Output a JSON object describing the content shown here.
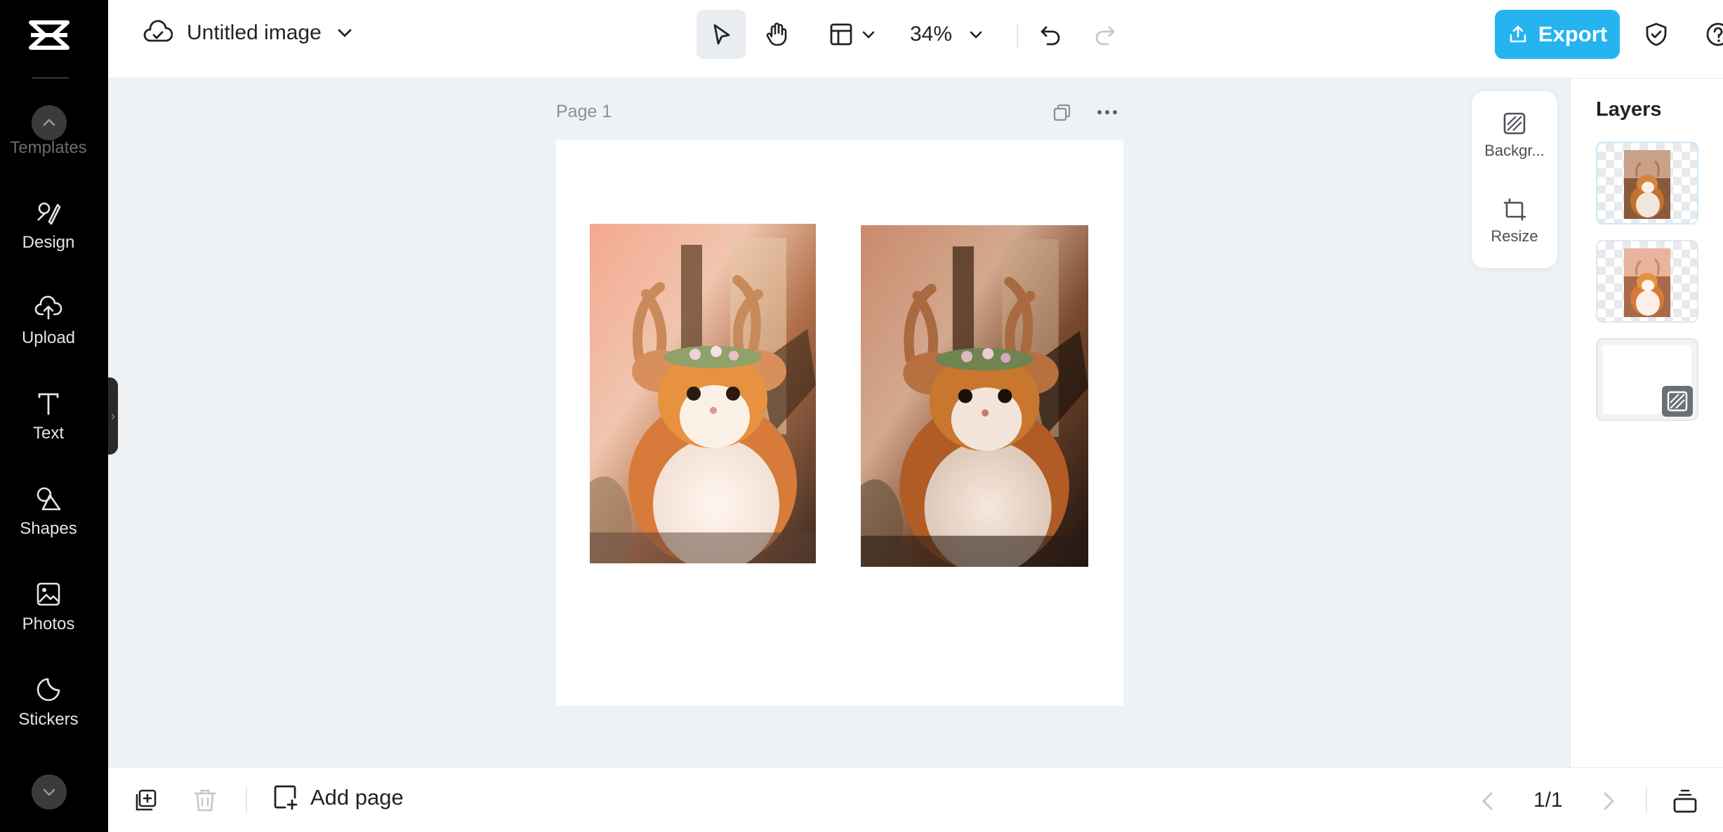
{
  "app": {
    "doc_title": "Untitled image",
    "zoom": "34%"
  },
  "sidebar": {
    "items": [
      {
        "label": "Templates",
        "icon": "templates-icon"
      },
      {
        "label": "Design",
        "icon": "design-icon"
      },
      {
        "label": "Upload",
        "icon": "upload-cloud-icon"
      },
      {
        "label": "Text",
        "icon": "text-icon"
      },
      {
        "label": "Shapes",
        "icon": "shapes-icon"
      },
      {
        "label": "Photos",
        "icon": "photos-icon"
      },
      {
        "label": "Stickers",
        "icon": "stickers-icon"
      }
    ]
  },
  "toolbar": {
    "export_label": "Export"
  },
  "canvas": {
    "page_label": "Page 1"
  },
  "float_tools": {
    "background_label": "Backgr...",
    "resize_label": "Resize"
  },
  "layers": {
    "title": "Layers"
  },
  "bottom": {
    "add_page_label": "Add page",
    "pager": "1/1"
  },
  "colors": {
    "accent": "#25b4f0",
    "sidebar_bg": "#000000",
    "canvas_bg": "#eff2f5"
  }
}
